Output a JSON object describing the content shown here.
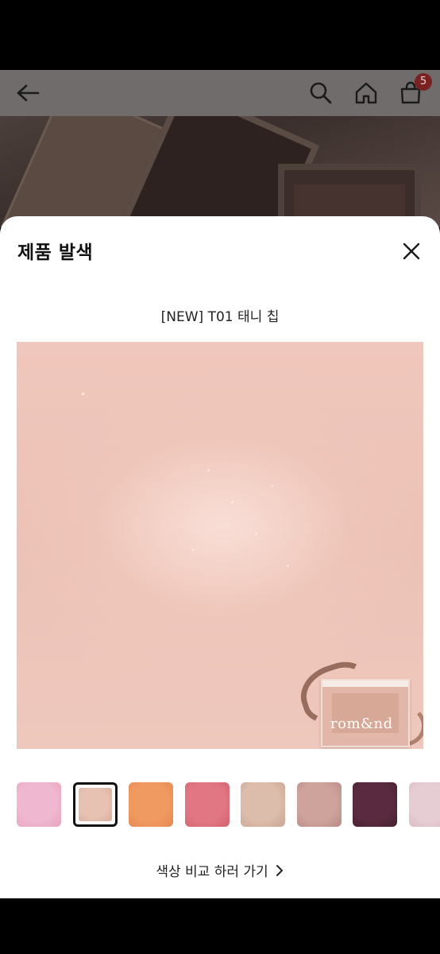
{
  "header": {
    "cart_count": "5",
    "icons": [
      "back-arrow-icon",
      "search-icon",
      "home-icon",
      "shopping-bag-icon"
    ]
  },
  "sheet": {
    "title": "제품 발색",
    "close_icon": "close-icon",
    "product_name": "[NEW] T01 태니 칩",
    "swatch_brand": "rom&nd",
    "compare_label": "색상 비교 하러 가기",
    "compare_icon": "chevron-right-icon"
  },
  "swatches": [
    {
      "color": "#f0b8d0",
      "edge": "#e6a3bf",
      "selected": false
    },
    {
      "color": "#e7c2b3",
      "edge": "#d9ad9c",
      "selected": true
    },
    {
      "color": "#f09a62",
      "edge": "#e5874f",
      "selected": false
    },
    {
      "color": "#e27784",
      "edge": "#d3616f",
      "selected": false
    },
    {
      "color": "#dcbcaa",
      "edge": "#caa693",
      "selected": false
    },
    {
      "color": "#cda39c",
      "edge": "#b98c85",
      "selected": false
    },
    {
      "color": "#5a2b40",
      "edge": "#44202f",
      "selected": false
    },
    {
      "color": "#e6cdd3",
      "edge": "#d6b9c0",
      "selected": false
    }
  ],
  "colors": {
    "scrim": "#6f6c6b",
    "badge": "#7a2222",
    "swatch_photo": "#efc6ba"
  }
}
